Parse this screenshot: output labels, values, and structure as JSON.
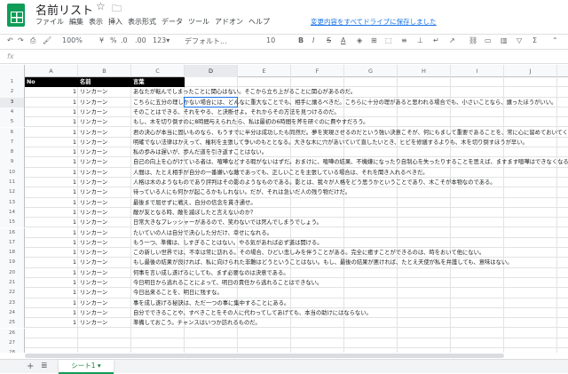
{
  "app": {
    "title": "名前リスト",
    "menu": [
      "ファイル",
      "編集",
      "表示",
      "挿入",
      "表示形式",
      "データ",
      "ツール",
      "アドオン",
      "ヘルプ"
    ],
    "save_status": "変更内容をすべてドライブに保存しました",
    "accent_color": "#0f9d58"
  },
  "toolbar": {
    "zoom": "100%",
    "currency": "¥",
    "percent": "%",
    "decimal_dec": ".0",
    "decimal_inc": ".00",
    "number_format": "123▾",
    "font": "デフォルト...",
    "font_size": "10",
    "bold": "B",
    "italic": "I",
    "strike": "S",
    "text_color": "A"
  },
  "formula_bar": {
    "label": "fx",
    "value": ""
  },
  "columns": [
    "A",
    "B",
    "C",
    "D",
    "E",
    "F",
    "G",
    "H",
    "I",
    "J"
  ],
  "active_column": "D",
  "active_row": "3",
  "table": {
    "headers": [
      "No",
      "名前",
      "言葉"
    ],
    "rows": [
      [
        "1",
        "リンカーン",
        "あなたが転んでしまったことに関心はない。そこから立ち上がることに関心があるのだ。"
      ],
      [
        "1",
        "リンカーン",
        "こちらに五分の理しかない場合には、どんなに重大なことでも、相手に譲るべきだ。こちらに十分の理があると思われる場合でも、小さいことなら、譲ったほうがいい。"
      ],
      [
        "1",
        "リンカーン",
        "そのことはできる、それをやる、と決断せよ。それからその方法を見つけるのだ。"
      ],
      [
        "1",
        "リンカーン",
        "もし、木を切り倒すのに8時間与えられたら、私は最初の6時間を斧を研ぐのに費やすだろう。"
      ],
      [
        "1",
        "リンカーン",
        "君の決心が本当に固いものなら、もうすでに半分は成功したも同然だ。夢を実現させるのだという強い決意こそが、何にもまして重要であることを、常に心に留めておいてくれたまえ。"
      ],
      [
        "1",
        "リンカーン",
        "明確でない法律はかえって、権利を主張して争いのもととなる。大きな木に穴があいていて直したいとき、ヒビを修繕するよりも、木を切り倒すほうが早い。"
      ],
      [
        "1",
        "リンカーン",
        "私の歩みは遅いが、歩んだ道を引き返すことはない。"
      ],
      [
        "1",
        "リンカーン",
        "自己の向上を心がけている者は、喧嘩などする暇がないはずだ。おまけに、喧嘩の結果、不機嫌になったり自制心を失ったりすることを思えば、ますます喧嘩はできなくなる。"
      ],
      [
        "1",
        "リンカーン",
        "人間は、たとえ相手が自分の一番嫌いな敵であっても、正しいことを主張している場合は、それを聞き入れるべきだ。"
      ],
      [
        "1",
        "リンカーン",
        "人格は木のようなものであり評判はその影のようなものである。影とは、我々が人格をどう思うかということであり、木こそが本物なのである。"
      ],
      [
        "1",
        "リンカーン",
        "待っている人にも何かが起こるかもしれない。だが、それは急いだ人の残り物だけだ。"
      ],
      [
        "1",
        "リンカーン",
        "最後まで屈せずに戦え、自分の信念を貫き通せ。"
      ],
      [
        "1",
        "リンカーン",
        "敵が友となる時、敵を滅ぼしたと言えないのか？"
      ],
      [
        "1",
        "リンカーン",
        "日常大きなプレッシャーがあるので、笑わないでは死んでしまうでしょう。"
      ],
      [
        "1",
        "リンカーン",
        "たいていの人は自分で決心した分だけ、幸せになれる。"
      ],
      [
        "1",
        "リンカーン",
        "もう一つ、準備は、しすぎることはない。やる気があれば必ず道は開ける。"
      ],
      [
        "1",
        "リンカーン",
        "この新しい世界では、不幸は常に訪れる。その場合、ひどい悲しみを伴うことがある。完全に癒すことができるのは、時をおいて他にない。"
      ],
      [
        "1",
        "リンカーン",
        "もし最後の結果が良ければ、私に向けられた非難はどうということはない。もし、最後の結果が悪ければ、たとえ天使が私を弁護しても、意味はない。"
      ],
      [
        "1",
        "リンカーン",
        "何事を言い成し遂げるにしても、まず必要なのは決意である。"
      ],
      [
        "1",
        "リンカーン",
        "今日明日から逃れることによって、明日の責任から逃れることはできない。"
      ],
      [
        "1",
        "リンカーン",
        "今日出来ることを、明日に残すな。"
      ],
      [
        "1",
        "リンカーン",
        "事を成し遂げる秘訣は、ただ一つの事に集中することにある。"
      ],
      [
        "1",
        "リンカーン",
        "自分でできることや、すべきことをその人に代わってしてあげても、本当の助けにはならない。"
      ],
      [
        "1",
        "リンカーン",
        "準備しておこう。チャンスはいつか訪れるものだ。"
      ]
    ]
  },
  "sheet_tab": "シート1 ▾"
}
